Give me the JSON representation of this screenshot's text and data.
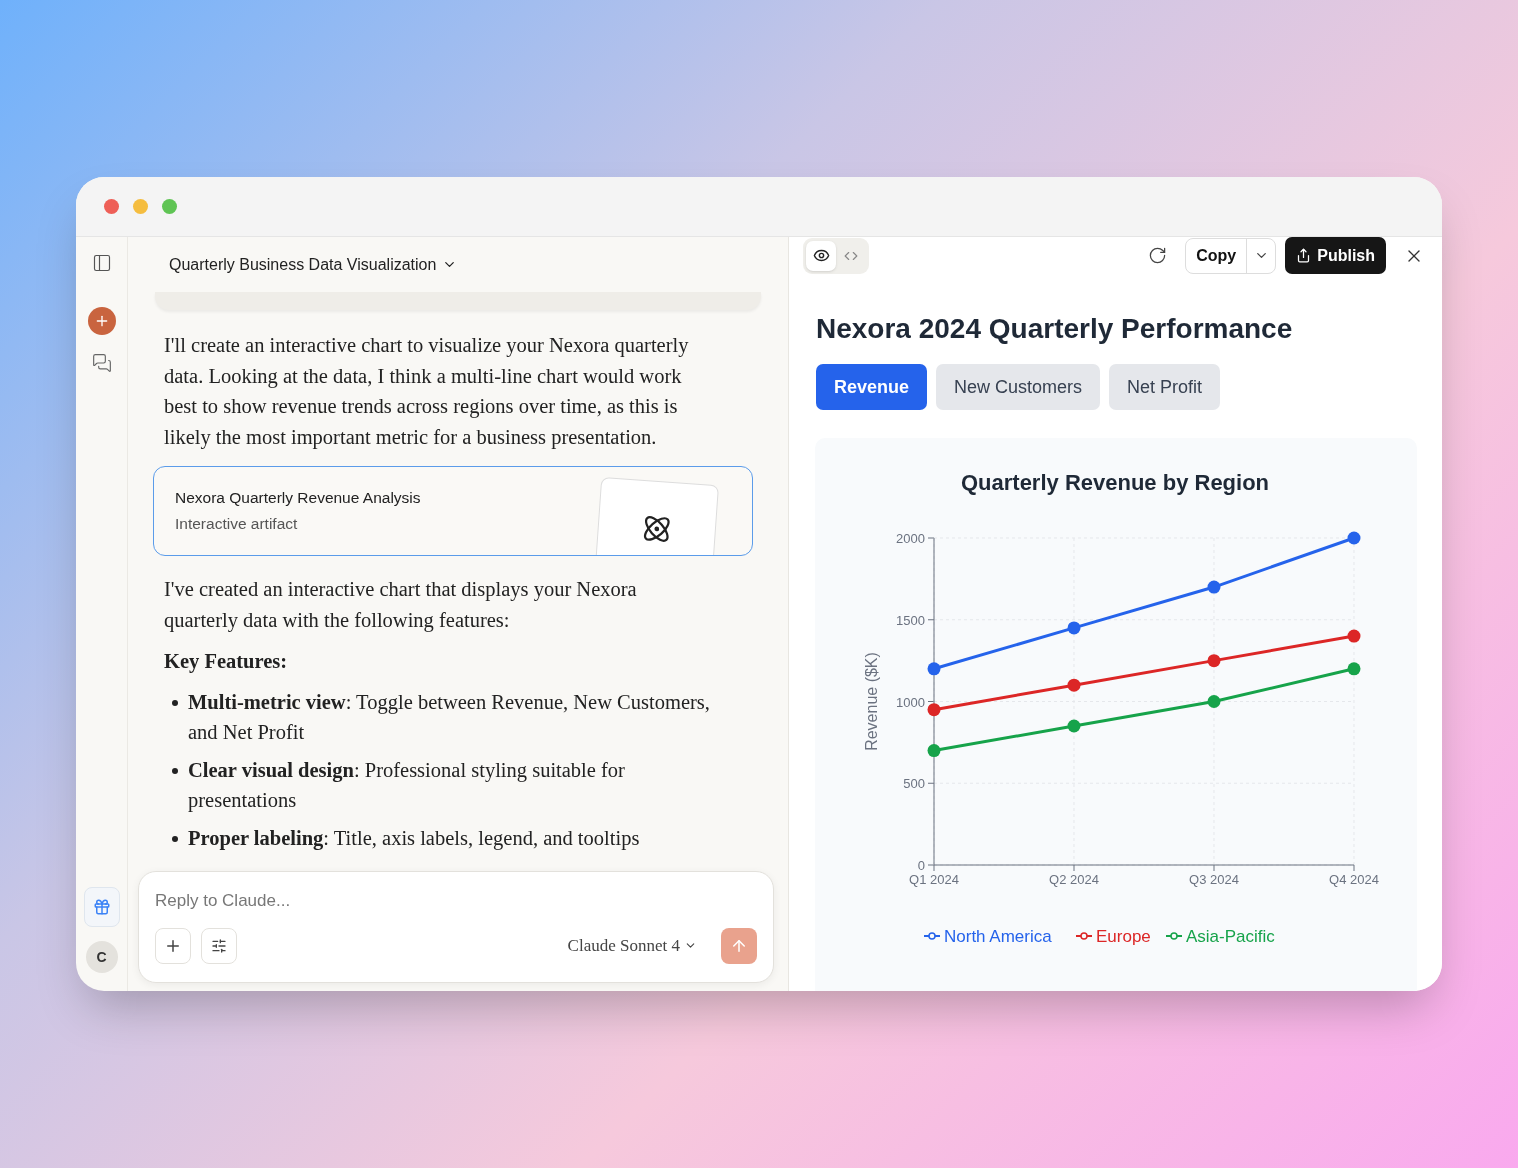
{
  "sidebar": {
    "avatar": "C"
  },
  "chat": {
    "title": "Quarterly Business Data Visualization",
    "intro": "I'll create an interactive chart to visualize your Nexora quarterly data. Looking at the data, I think a multi-line chart would work best to show revenue trends across regions over time, as this is likely the most important metric for a business presentation.",
    "artifact": {
      "title": "Nexora Quarterly Revenue Analysis",
      "subtitle": "Interactive artifact"
    },
    "summary": "I've created an interactive chart that displays your Nexora quarterly data with the following features:",
    "features_heading": "Key Features:",
    "features": [
      "**Multi-metric view**: Toggle between Revenue, New Customers, and Net Profit",
      "**Clear visual design**: Professional styling suitable for presentations",
      "**Proper labeling**: Title, axis labels, legend, and tooltips"
    ]
  },
  "composer": {
    "placeholder": "Reply to Claude...",
    "model": "Claude Sonnet 4"
  },
  "artifact_panel": {
    "view_toggle": [
      {
        "kind": "preview",
        "selected": true
      },
      {
        "kind": "code",
        "selected": false
      }
    ],
    "copy_label": "Copy",
    "publish_label": "Publish",
    "heading": "Nexora 2024 Quarterly Performance",
    "tabs": [
      {
        "label": "Revenue",
        "selected": true
      },
      {
        "label": "New Customers",
        "selected": false
      },
      {
        "label": "Net Profit",
        "selected": false
      }
    ],
    "chart_data": {
      "type": "line",
      "title": "Quarterly Revenue by Region",
      "ylabel": "Revenue ($K)",
      "categories": [
        "Q1 2024",
        "Q2 2024",
        "Q3 2024",
        "Q4 2024"
      ],
      "series": [
        {
          "name": "North America",
          "color": "#2563eb",
          "marker": "circle",
          "values": [
            1200,
            1450,
            1700,
            2000
          ]
        },
        {
          "name": "Europe",
          "color": "#dc2626",
          "marker": "circle",
          "values": [
            950,
            1100,
            1250,
            1400
          ]
        },
        {
          "name": "Asia-Pacific",
          "color": "#16a34a",
          "marker": "circle",
          "values": [
            700,
            850,
            1000,
            1200
          ]
        }
      ],
      "ylim": [
        0,
        2000
      ],
      "yticks": [
        0,
        500,
        1000,
        1500,
        2000
      ],
      "grid": true,
      "legend": true
    }
  }
}
